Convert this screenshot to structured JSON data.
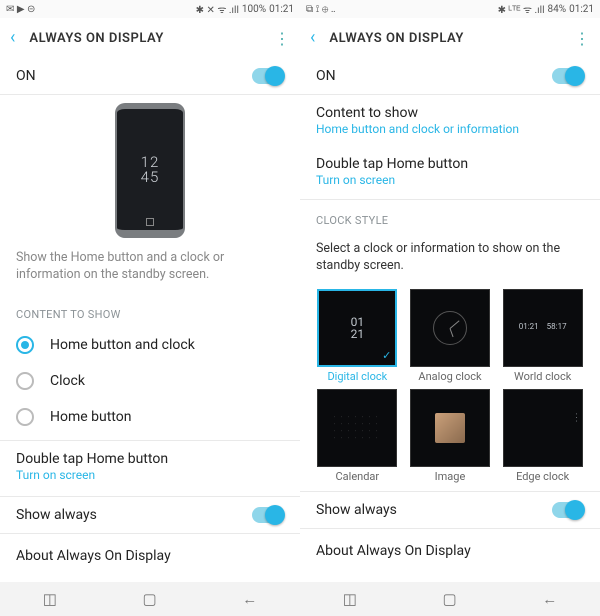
{
  "left": {
    "status": {
      "left_icons": "✉ ▶ ⊝",
      "right_icons": "✱ ✕ ᯤ .ıll",
      "battery": "100%",
      "time": "01:21"
    },
    "header": {
      "title": "ALWAYS ON DISPLAY"
    },
    "on_label": "ON",
    "preview_time_top": "12",
    "preview_time_bot": "45",
    "description": "Show the Home button and a clock or information on the standby screen.",
    "content_label": "CONTENT TO SHOW",
    "radios": {
      "r0": "Home button and clock",
      "r1": "Clock",
      "r2": "Home button"
    },
    "double_tap": {
      "title": "Double tap Home button",
      "sub": "Turn on screen"
    },
    "show_always": "Show always",
    "about": "About Always On Display"
  },
  "right": {
    "status": {
      "left_icons": "⧉ ⟟ ⊕ ‥",
      "right_icons": "✱ ᴸᵀᴱ ᯤ .ıll",
      "battery": "84%",
      "time": "01:21"
    },
    "header": {
      "title": "ALWAYS ON DISPLAY"
    },
    "on_label": "ON",
    "content": {
      "title": "Content to show",
      "sub": "Home button and clock or information"
    },
    "double_tap": {
      "title": "Double tap Home button",
      "sub": "Turn on screen"
    },
    "clock_label": "CLOCK STYLE",
    "clock_desc": "Select a clock or information to show on the standby screen.",
    "tiles": {
      "t0": "Digital clock",
      "t1": "Analog clock",
      "t2": "World clock",
      "t3": "Calendar",
      "t4": "Image",
      "t5": "Edge clock"
    },
    "digital_time": "01\n21",
    "world1": "01:21",
    "world2": "58:17",
    "show_always": "Show always",
    "about": "About Always On Display"
  }
}
